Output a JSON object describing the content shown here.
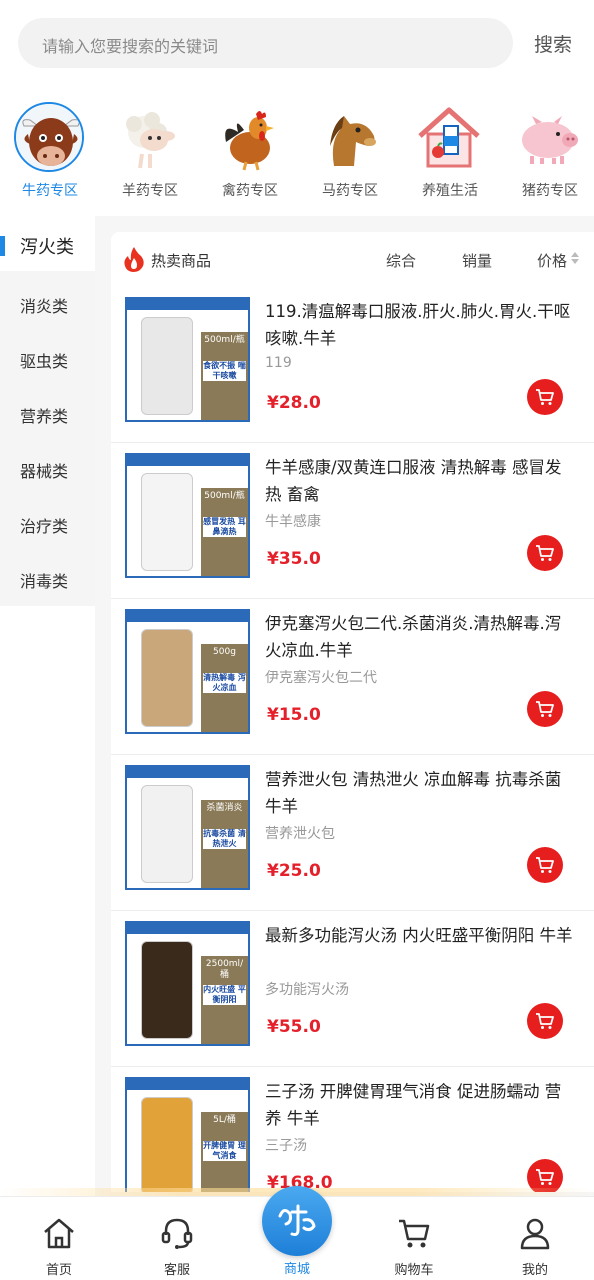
{
  "search": {
    "placeholder": "请输入您要搜索的关键词",
    "button": "搜索"
  },
  "categories": [
    {
      "label": "牛药专区",
      "icon": "cow-icon",
      "active": true
    },
    {
      "label": "羊药专区",
      "icon": "sheep-icon",
      "active": false
    },
    {
      "label": "禽药专区",
      "icon": "rooster-icon",
      "active": false
    },
    {
      "label": "马药专区",
      "icon": "horse-icon",
      "active": false
    },
    {
      "label": "养殖生活",
      "icon": "farm-house-icon",
      "active": false
    },
    {
      "label": "猪药专区",
      "icon": "pig-icon",
      "active": false
    }
  ],
  "sidebar": {
    "items": [
      {
        "label": "泻火类",
        "active": true
      },
      {
        "label": "消炎类",
        "active": false
      },
      {
        "label": "驱虫类",
        "active": false
      },
      {
        "label": "营养类",
        "active": false
      },
      {
        "label": "器械类",
        "active": false
      },
      {
        "label": "治疗类",
        "active": false
      },
      {
        "label": "消毒类",
        "active": false
      }
    ]
  },
  "listing": {
    "title": "热卖商品",
    "sort_comprehensive": "综合",
    "sort_sales": "销量",
    "sort_price": "价格"
  },
  "products": [
    {
      "title": "119.清瘟解毒口服液.肝火.肺火.胃火.干呕咳嗽.牛羊",
      "subtitle": "119",
      "price": "¥28.0",
      "img_caption": "500ml/瓶",
      "img_caption2": "食欲不振 喘干咳嗽",
      "product_color": "#e8e8e8"
    },
    {
      "title": "牛羊感康/双黄连口服液 清热解毒 感冒发热 畜禽",
      "subtitle": "牛羊感康",
      "price": "¥35.0",
      "img_caption": "500ml/瓶",
      "img_caption2": "感冒发热 耳鼻滴热",
      "product_color": "#f4f4f4"
    },
    {
      "title": "伊克塞泻火包二代.杀菌消炎.清热解毒.泻火凉血.牛羊",
      "subtitle": "伊克塞泻火包二代",
      "price": "¥15.0",
      "img_caption": "500g",
      "img_caption2": "清热解毒 泻火凉血",
      "product_color": "#c9a77a"
    },
    {
      "title": "营养泄火包 清热泄火 凉血解毒 抗毒杀菌 牛羊",
      "subtitle": "营养泄火包",
      "price": "¥25.0",
      "img_caption": "杀菌消炎",
      "img_caption2": "抗毒杀菌 清热泄火",
      "product_color": "#f1f1f1"
    },
    {
      "title": "最新多功能泻火汤 内火旺盛平衡阴阳 牛羊",
      "subtitle": "多功能泻火汤",
      "price": "¥55.0",
      "img_caption": "2500ml/桶",
      "img_caption2": "内火旺盛 平衡阴阳",
      "product_color": "#3a2a1c"
    },
    {
      "title": "三子汤 开脾健胃理气消食 促进肠蠕动 营养 牛羊",
      "subtitle": "三子汤",
      "price": "¥168.0",
      "img_caption": "5L/桶",
      "img_caption2": "开脾健胃 理气消食",
      "product_color": "#e2a23a"
    }
  ],
  "tabbar": [
    {
      "label": "首页",
      "icon": "home-icon"
    },
    {
      "label": "客服",
      "icon": "headset-icon"
    },
    {
      "label": "商城",
      "icon": "mall-icon",
      "active": true
    },
    {
      "label": "购物车",
      "icon": "cart-icon"
    },
    {
      "label": "我的",
      "icon": "user-icon"
    }
  ],
  "colors": {
    "accent": "#1e88e5",
    "price": "#e4202a",
    "cart_button": "#e61e1e"
  }
}
